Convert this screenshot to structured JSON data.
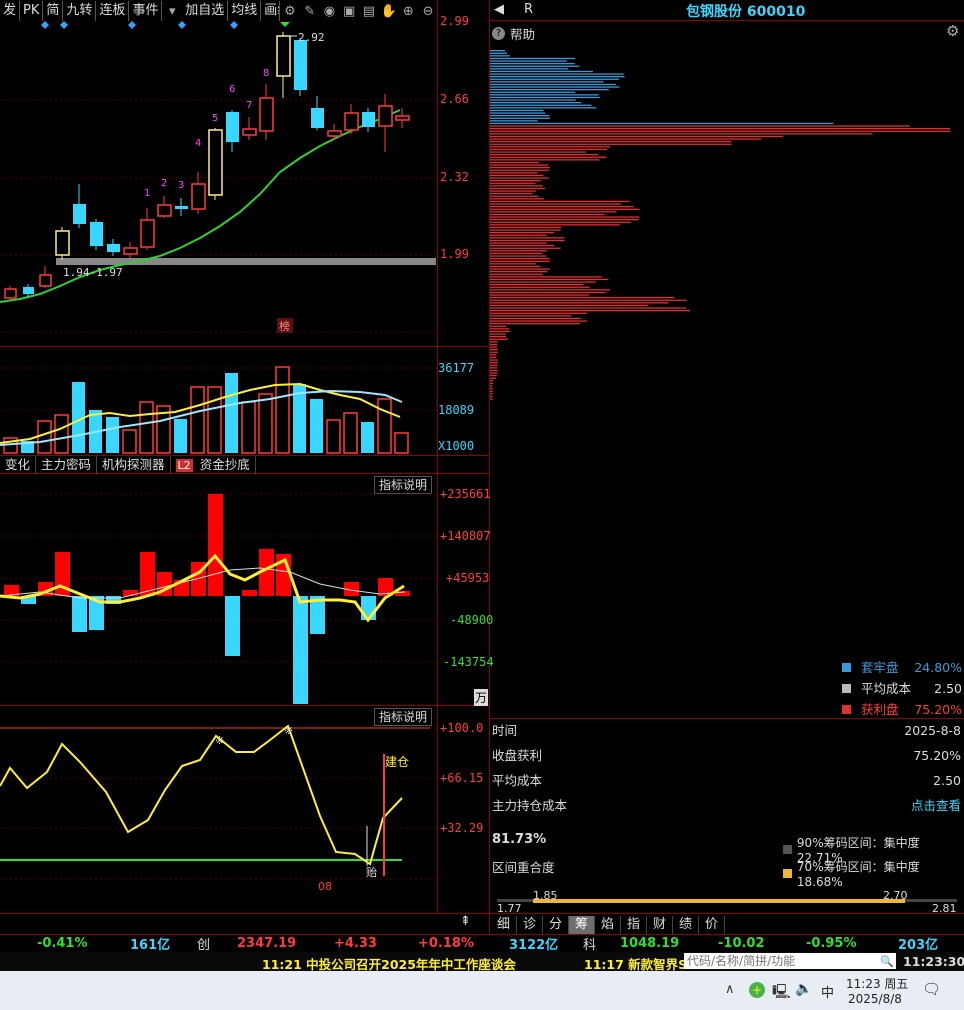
{
  "toolbar": {
    "buttons": [
      "发",
      "PK",
      "简",
      "九转",
      "连板",
      "事件",
      "加自选",
      "均线",
      "画线"
    ]
  },
  "stock": {
    "title": "包钢股份 600010",
    "r_label": "R"
  },
  "help_label": "帮助",
  "price_axis": [
    "2.99",
    "2.66",
    "2.32",
    "1.99"
  ],
  "price_annotations": {
    "high": "2.92",
    "range": "1.94-1.97",
    "bang": "榜"
  },
  "candle_numbers": [
    "1",
    "2",
    "3",
    "4",
    "5",
    "6",
    "7",
    "8"
  ],
  "vol_axis": [
    "36177",
    "18089",
    "X1000"
  ],
  "tabs": [
    "变化",
    "主力密码",
    "机构探测器",
    "L2",
    "资金抄底"
  ],
  "indicator_label": "指标说明",
  "ind1_axis": [
    "+235661",
    "+140807",
    "+45953",
    "-48900",
    "-143754"
  ],
  "ind1_unit": "万",
  "ind2_axis": [
    "+100.0",
    "+66.15",
    "+32.29"
  ],
  "ind2_annotations": {
    "build": "建仓",
    "mark": "8",
    "date_label": "08",
    "low_mark": "贻"
  },
  "chip_legend": [
    {
      "label": "套牢盘",
      "value": "24.80%",
      "color": "#3a9ad9"
    },
    {
      "label": "平均成本",
      "value": "2.50",
      "color": "#bbbbbb"
    },
    {
      "label": "获利盘",
      "value": "75.20%",
      "color": "#e03030"
    }
  ],
  "info": [
    {
      "label": "时间",
      "value": "2025-8-8"
    },
    {
      "label": "收盘获利",
      "value": "75.20%"
    },
    {
      "label": "平均成本",
      "value": "2.50"
    },
    {
      "label": "主力持仓成本",
      "value": "点击查看"
    }
  ],
  "concentration": {
    "pct": "81.73%",
    "overlap_label": "区间重合度",
    "c90": "90%筹码区间：集中度22.71%",
    "c70": "70%筹码区间：集中度18.68%"
  },
  "range_bar": {
    "low": "1.77",
    "high": "2.81",
    "inner_low": "1.85",
    "inner_high": "2.70"
  },
  "bottom_tabs": [
    "细",
    "诊",
    "分",
    "筹",
    "焰",
    "指",
    "财",
    "绩",
    "价"
  ],
  "market": [
    {
      "text": "-0.41%",
      "color": "#2ee02e"
    },
    {
      "text": "161亿",
      "color": "#39d6ff"
    },
    {
      "text": "创",
      "color": "#dddddd"
    },
    {
      "text": "2347.19",
      "color": "#ff3b3b"
    },
    {
      "text": "+4.33",
      "color": "#ff3b3b"
    },
    {
      "text": "+0.18%",
      "color": "#ff3b3b"
    },
    {
      "text": "3122亿",
      "color": "#39d6ff"
    },
    {
      "text": "科",
      "color": "#dddddd"
    },
    {
      "text": "1048.19",
      "color": "#2ee02e"
    },
    {
      "text": "-10.02",
      "color": "#2ee02e"
    },
    {
      "text": "-0.95%",
      "color": "#2ee02e"
    },
    {
      "text": "203亿",
      "color": "#39d6ff"
    }
  ],
  "news": {
    "item1": "11:21 中投公司召开2025年年中工作座谈会",
    "item2": "11:17 新款智界S"
  },
  "search_placeholder": "代码/名称/简拼/功能",
  "clock": "11:23:30",
  "taskbar": {
    "time": "11:23 周五",
    "date": "2025/8/8",
    "ime": "中"
  }
}
